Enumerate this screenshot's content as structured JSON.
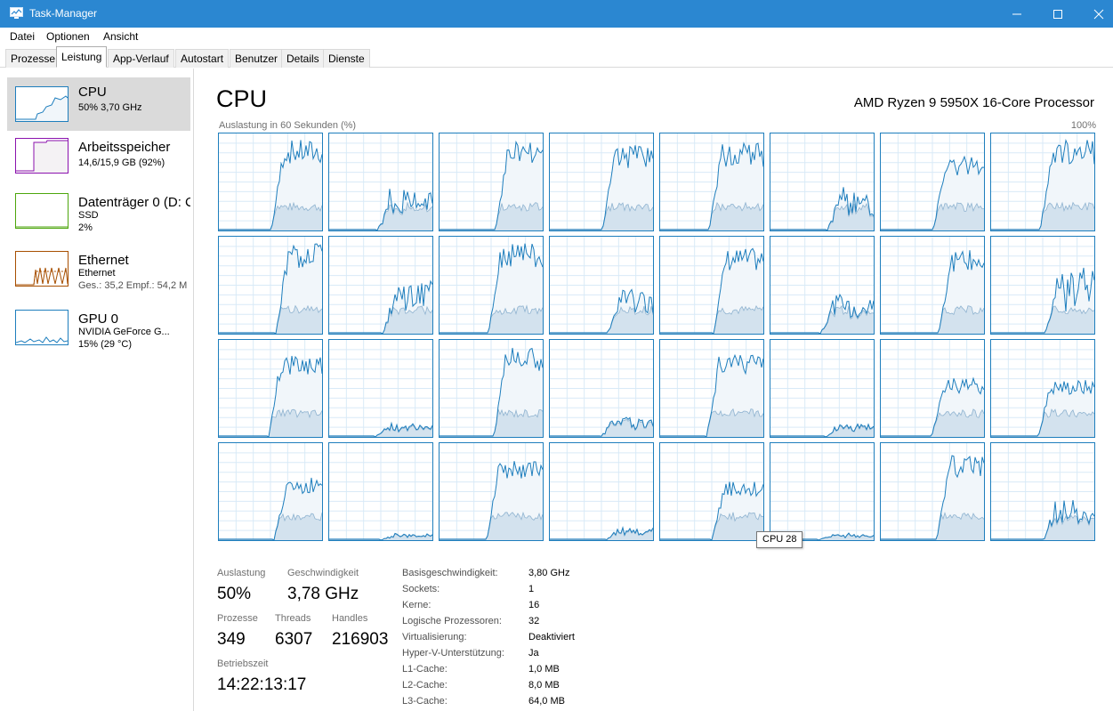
{
  "window": {
    "title": "Task-Manager"
  },
  "menu": [
    {
      "label": "Datei"
    },
    {
      "label": "Optionen"
    },
    {
      "label": "Ansicht"
    }
  ],
  "tabs": [
    {
      "label": "Prozesse"
    },
    {
      "label": "Leistung"
    },
    {
      "label": "App-Verlauf"
    },
    {
      "label": "Autostart"
    },
    {
      "label": "Benutzer"
    },
    {
      "label": "Details"
    },
    {
      "label": "Dienste"
    }
  ],
  "active_tab": "Leistung",
  "sidebar": {
    "items": [
      {
        "title": "CPU",
        "sub1": "50% 3,70 GHz",
        "sub2": "",
        "sub3": "",
        "color": "#1e7ebd"
      },
      {
        "title": "Arbeitsspeicher",
        "sub1": "14,6/15,9 GB (92%)",
        "sub2": "",
        "sub3": "",
        "color": "#8b12ae"
      },
      {
        "title": "Datenträger 0 (D: C",
        "sub1": "SSD",
        "sub2": "2%",
        "sub3": "",
        "color": "#4da60c"
      },
      {
        "title": "Ethernet",
        "sub1": "Ethernet",
        "sub2": "Ges.: 35,2 Empf.: 54,2 M",
        "sub3": "",
        "color": "#a74f01"
      },
      {
        "title": "GPU 0",
        "sub1": "NVIDIA GeForce G...",
        "sub2": "15% (29 °C)",
        "sub3": "",
        "color": "#1e7ebd"
      }
    ]
  },
  "main": {
    "title": "CPU",
    "model": "AMD Ryzen 9 5950X 16-Core Processor",
    "graph_label": "Auslastung in 60 Sekunden (%)",
    "graph_max": "100%",
    "tooltip": "CPU 28"
  },
  "core_levels": [
    0.85,
    0.3,
    0.85,
    0.8,
    0.82,
    0.3,
    0.7,
    0.85,
    0.85,
    0.4,
    0.85,
    0.35,
    0.8,
    0.3,
    0.8,
    0.45,
    0.8,
    0.1,
    0.85,
    0.15,
    0.8,
    0.1,
    0.55,
    0.55,
    0.6,
    0.05,
    0.75,
    0.1,
    0.55,
    0.05,
    0.8,
    0.3
  ],
  "stats": {
    "auslastung": {
      "label": "Auslastung",
      "value": "50%"
    },
    "geschwindigkeit": {
      "label": "Geschwindigkeit",
      "value": "3,78 GHz"
    },
    "prozesse": {
      "label": "Prozesse",
      "value": "349"
    },
    "threads": {
      "label": "Threads",
      "value": "6307"
    },
    "handles": {
      "label": "Handles",
      "value": "216903"
    },
    "betriebszeit": {
      "label": "Betriebszeit",
      "value": "14:22:13:17"
    }
  },
  "info": [
    {
      "label": "Basisgeschwindigkeit:",
      "value": "3,80 GHz"
    },
    {
      "label": "Sockets:",
      "value": "1"
    },
    {
      "label": "Kerne:",
      "value": "16"
    },
    {
      "label": "Logische Prozessoren:",
      "value": "32"
    },
    {
      "label": "Virtualisierung:",
      "value": "Deaktiviert"
    },
    {
      "label": "Hyper-V-Unterstützung:",
      "value": "Ja"
    },
    {
      "label": "L1-Cache:",
      "value": "1,0 MB"
    },
    {
      "label": "L2-Cache:",
      "value": "8,0 MB"
    },
    {
      "label": "L3-Cache:",
      "value": "64,0 MB"
    }
  ]
}
